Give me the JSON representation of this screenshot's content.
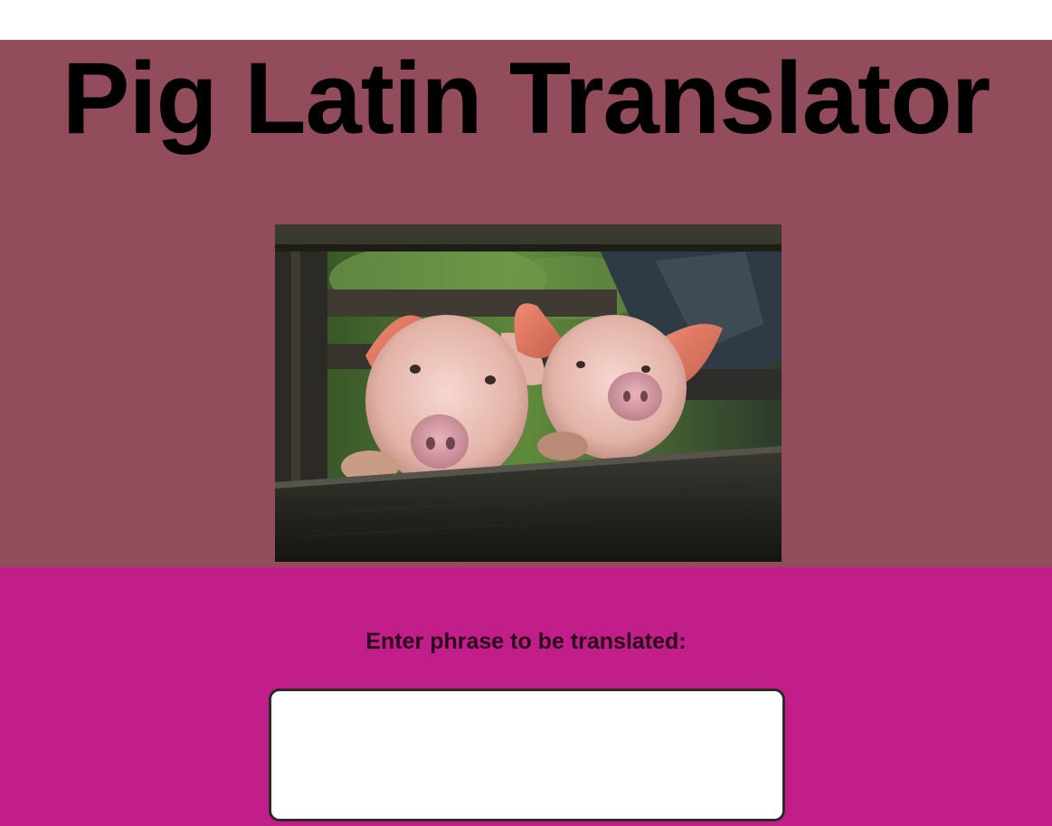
{
  "header": {
    "title": "Pig Latin Translator",
    "background_color": "#934c5c",
    "image": {
      "subject": "two pigs looking over a wooden fence",
      "icon": "pig-photo"
    }
  },
  "translator": {
    "background_color": "#c11e89",
    "prompt_label": "Enter phrase to be translated:",
    "input_value": "",
    "input_placeholder": ""
  }
}
